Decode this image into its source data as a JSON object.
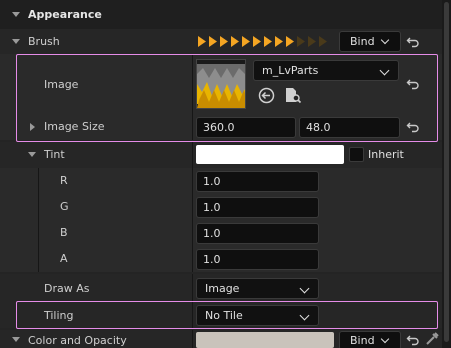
{
  "sections": {
    "appearance": "Appearance",
    "brush": "Brush",
    "image": "Image",
    "image_size": "Image Size",
    "tint": "Tint",
    "r": "R",
    "g": "G",
    "b": "B",
    "a": "A",
    "draw_as": "Draw As",
    "tiling": "Tiling",
    "color_and_opacity": "Color and Opacity"
  },
  "brush": {
    "bind_label": "Bind",
    "pin_icon_count": 12,
    "pin_icon_active": 9,
    "pin_color": "#f5a623"
  },
  "image": {
    "asset_name": "m_LvParts",
    "use_icon": "arrow-left-circle-icon",
    "browse_icon": "browse-asset-icon"
  },
  "image_size": {
    "x": "360.0",
    "y": "48.0"
  },
  "tint": {
    "color": "#ffffff",
    "inherit_label": "Inherit",
    "r": "1.0",
    "g": "1.0",
    "b": "1.0",
    "a": "1.0"
  },
  "draw_as": {
    "value": "Image"
  },
  "tiling": {
    "value": "No Tile"
  },
  "color_and_opacity": {
    "bind_label": "Bind",
    "swatch_color": "#c9c3bb"
  },
  "colors": {
    "highlight": "#e58ce8",
    "panel_bg": "#242424"
  }
}
